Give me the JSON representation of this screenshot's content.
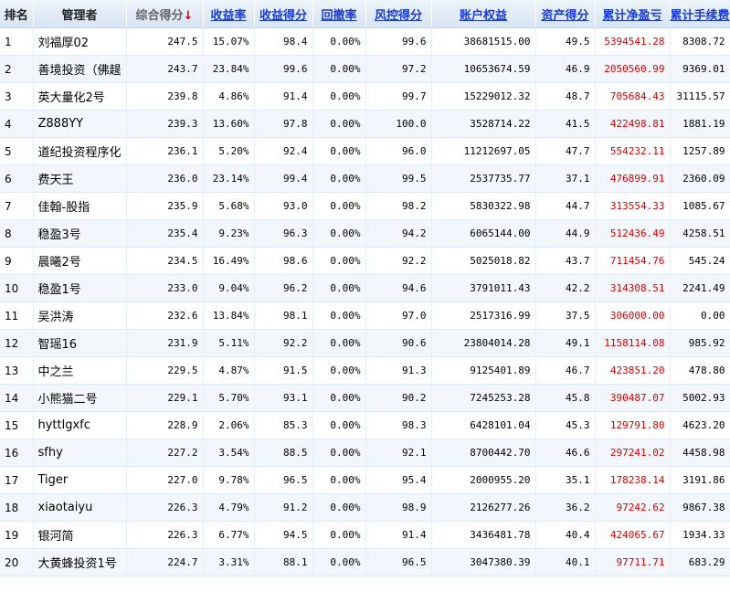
{
  "table": {
    "headers": [
      {
        "label": "排名",
        "style": "plain"
      },
      {
        "label": "管理者",
        "style": "plain"
      },
      {
        "label": "综合得分",
        "style": "sorted",
        "arrow": "↓"
      },
      {
        "label": "收益率",
        "style": "sortable"
      },
      {
        "label": "收益得分",
        "style": "sortable"
      },
      {
        "label": "回撤率",
        "style": "sortable"
      },
      {
        "label": "风控得分",
        "style": "sortable"
      },
      {
        "label": "账户权益",
        "style": "sortable"
      },
      {
        "label": "资产得分",
        "style": "sortable"
      },
      {
        "label": "累计净盈亏",
        "style": "sortable"
      },
      {
        "label": "累计手续费",
        "style": "sortable"
      }
    ],
    "rows": [
      {
        "rank": "1",
        "manager": "刘福厚02",
        "score": "247.5",
        "return_rate": "15.07%",
        "return_score": "98.4",
        "drawdown": "0.00%",
        "risk_score": "99.6",
        "equity": "38681515.00",
        "asset_score": "49.5",
        "net_pnl": "5394541.28",
        "fee": "8308.72"
      },
      {
        "rank": "2",
        "manager": "善境投资（佛趧",
        "score": "243.7",
        "return_rate": "23.84%",
        "return_score": "99.6",
        "drawdown": "0.00%",
        "risk_score": "97.2",
        "equity": "10653674.59",
        "asset_score": "46.9",
        "net_pnl": "2050560.99",
        "fee": "9369.01"
      },
      {
        "rank": "3",
        "manager": "英大量化2号",
        "score": "239.8",
        "return_rate": "4.86%",
        "return_score": "91.4",
        "drawdown": "0.00%",
        "risk_score": "99.7",
        "equity": "15229012.32",
        "asset_score": "48.7",
        "net_pnl": "705684.43",
        "fee": "31115.57"
      },
      {
        "rank": "4",
        "manager": "Z888YY",
        "score": "239.3",
        "return_rate": "13.60%",
        "return_score": "97.8",
        "drawdown": "0.00%",
        "risk_score": "100.0",
        "equity": "3528714.22",
        "asset_score": "41.5",
        "net_pnl": "422498.81",
        "fee": "1881.19"
      },
      {
        "rank": "5",
        "manager": "道纪投资程序化",
        "score": "236.1",
        "return_rate": "5.20%",
        "return_score": "92.4",
        "drawdown": "0.00%",
        "risk_score": "96.0",
        "equity": "11212697.05",
        "asset_score": "47.7",
        "net_pnl": "554232.11",
        "fee": "1257.89"
      },
      {
        "rank": "6",
        "manager": "费天王",
        "score": "236.0",
        "return_rate": "23.14%",
        "return_score": "99.4",
        "drawdown": "0.00%",
        "risk_score": "99.5",
        "equity": "2537735.77",
        "asset_score": "37.1",
        "net_pnl": "476899.91",
        "fee": "2360.09"
      },
      {
        "rank": "7",
        "manager": "佳翰-股指",
        "score": "235.9",
        "return_rate": "5.68%",
        "return_score": "93.0",
        "drawdown": "0.00%",
        "risk_score": "98.2",
        "equity": "5830322.98",
        "asset_score": "44.7",
        "net_pnl": "313554.33",
        "fee": "1085.67"
      },
      {
        "rank": "8",
        "manager": "稳盈3号",
        "score": "235.4",
        "return_rate": "9.23%",
        "return_score": "96.3",
        "drawdown": "0.00%",
        "risk_score": "94.2",
        "equity": "6065144.00",
        "asset_score": "44.9",
        "net_pnl": "512436.49",
        "fee": "4258.51"
      },
      {
        "rank": "9",
        "manager": "晨曦2号",
        "score": "234.5",
        "return_rate": "16.49%",
        "return_score": "98.6",
        "drawdown": "0.00%",
        "risk_score": "92.2",
        "equity": "5025018.82",
        "asset_score": "43.7",
        "net_pnl": "711454.76",
        "fee": "545.24"
      },
      {
        "rank": "10",
        "manager": "稳盈1号",
        "score": "233.0",
        "return_rate": "9.04%",
        "return_score": "96.2",
        "drawdown": "0.00%",
        "risk_score": "94.6",
        "equity": "3791011.43",
        "asset_score": "42.2",
        "net_pnl": "314308.51",
        "fee": "2241.49"
      },
      {
        "rank": "11",
        "manager": "吴洪涛",
        "score": "232.6",
        "return_rate": "13.84%",
        "return_score": "98.1",
        "drawdown": "0.00%",
        "risk_score": "97.0",
        "equity": "2517316.99",
        "asset_score": "37.5",
        "net_pnl": "306000.00",
        "fee": "0.00"
      },
      {
        "rank": "12",
        "manager": "智瑶16",
        "score": "231.9",
        "return_rate": "5.11%",
        "return_score": "92.2",
        "drawdown": "0.00%",
        "risk_score": "90.6",
        "equity": "23804014.28",
        "asset_score": "49.1",
        "net_pnl": "1158114.08",
        "fee": "985.92"
      },
      {
        "rank": "13",
        "manager": "中之兰",
        "score": "229.5",
        "return_rate": "4.87%",
        "return_score": "91.5",
        "drawdown": "0.00%",
        "risk_score": "91.3",
        "equity": "9125401.89",
        "asset_score": "46.7",
        "net_pnl": "423851.20",
        "fee": "478.80"
      },
      {
        "rank": "14",
        "manager": "小熊猫二号",
        "score": "229.1",
        "return_rate": "5.70%",
        "return_score": "93.1",
        "drawdown": "0.00%",
        "risk_score": "90.2",
        "equity": "7245253.28",
        "asset_score": "45.8",
        "net_pnl": "390487.07",
        "fee": "5002.93"
      },
      {
        "rank": "15",
        "manager": "hyttlgxfc",
        "score": "228.9",
        "return_rate": "2.06%",
        "return_score": "85.3",
        "drawdown": "0.00%",
        "risk_score": "98.3",
        "equity": "6428101.04",
        "asset_score": "45.3",
        "net_pnl": "129791.80",
        "fee": "4623.20"
      },
      {
        "rank": "16",
        "manager": "sfhy",
        "score": "227.2",
        "return_rate": "3.54%",
        "return_score": "88.5",
        "drawdown": "0.00%",
        "risk_score": "92.1",
        "equity": "8700442.70",
        "asset_score": "46.6",
        "net_pnl": "297241.02",
        "fee": "4458.98"
      },
      {
        "rank": "17",
        "manager": "Tiger",
        "score": "227.0",
        "return_rate": "9.78%",
        "return_score": "96.5",
        "drawdown": "0.00%",
        "risk_score": "95.4",
        "equity": "2000955.20",
        "asset_score": "35.1",
        "net_pnl": "178238.14",
        "fee": "3191.86"
      },
      {
        "rank": "18",
        "manager": "xiaotaiyu",
        "score": "226.3",
        "return_rate": "4.79%",
        "return_score": "91.2",
        "drawdown": "0.00%",
        "risk_score": "98.9",
        "equity": "2126277.26",
        "asset_score": "36.2",
        "net_pnl": "97242.62",
        "fee": "9867.38"
      },
      {
        "rank": "19",
        "manager": "银河简",
        "score": "226.3",
        "return_rate": "6.77%",
        "return_score": "94.5",
        "drawdown": "0.00%",
        "risk_score": "91.4",
        "equity": "3436481.78",
        "asset_score": "40.4",
        "net_pnl": "424065.67",
        "fee": "1934.33"
      },
      {
        "rank": "20",
        "manager": "大黄蜂投资1号",
        "score": "224.7",
        "return_rate": "3.31%",
        "return_score": "88.1",
        "drawdown": "0.00%",
        "risk_score": "96.5",
        "equity": "3047380.39",
        "asset_score": "40.1",
        "net_pnl": "97711.71",
        "fee": "683.29"
      }
    ],
    "colors": {
      "header_link": "#1a3bd1",
      "sort_arrow": "#e00000",
      "net_pnl_text": "#d40000",
      "row_alt_bg": "#f3f7fc"
    }
  }
}
